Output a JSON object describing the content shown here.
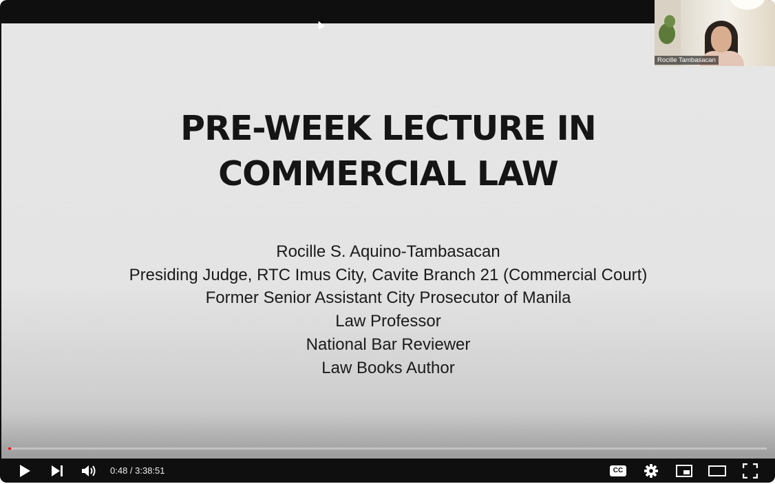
{
  "slide": {
    "title_lines": [
      "PRE-WEEK LECTURE IN",
      "COMMERCIAL LAW"
    ],
    "details": [
      "Rocille S. Aquino-Tambasacan",
      "Presiding Judge, RTC Imus City, Cavite Branch 21 (Commercial Court)",
      "Former Senior Assistant City Prosecutor of Manila",
      "Law Professor",
      "National Bar Reviewer",
      "Law Books Author"
    ]
  },
  "webcam": {
    "participant_name": "Rocille Tambasacan"
  },
  "player": {
    "current_time": "0:48",
    "duration": "3:38:51",
    "time_display": "0:48 / 3:38:51",
    "progress_fraction": 0.0037,
    "accent_color": "#ff0000",
    "cc_label": "CC",
    "icons": [
      "play-icon",
      "next-icon",
      "volume-icon",
      "captions-icon",
      "settings-icon",
      "miniplayer-icon",
      "theater-icon",
      "fullscreen-icon"
    ]
  }
}
